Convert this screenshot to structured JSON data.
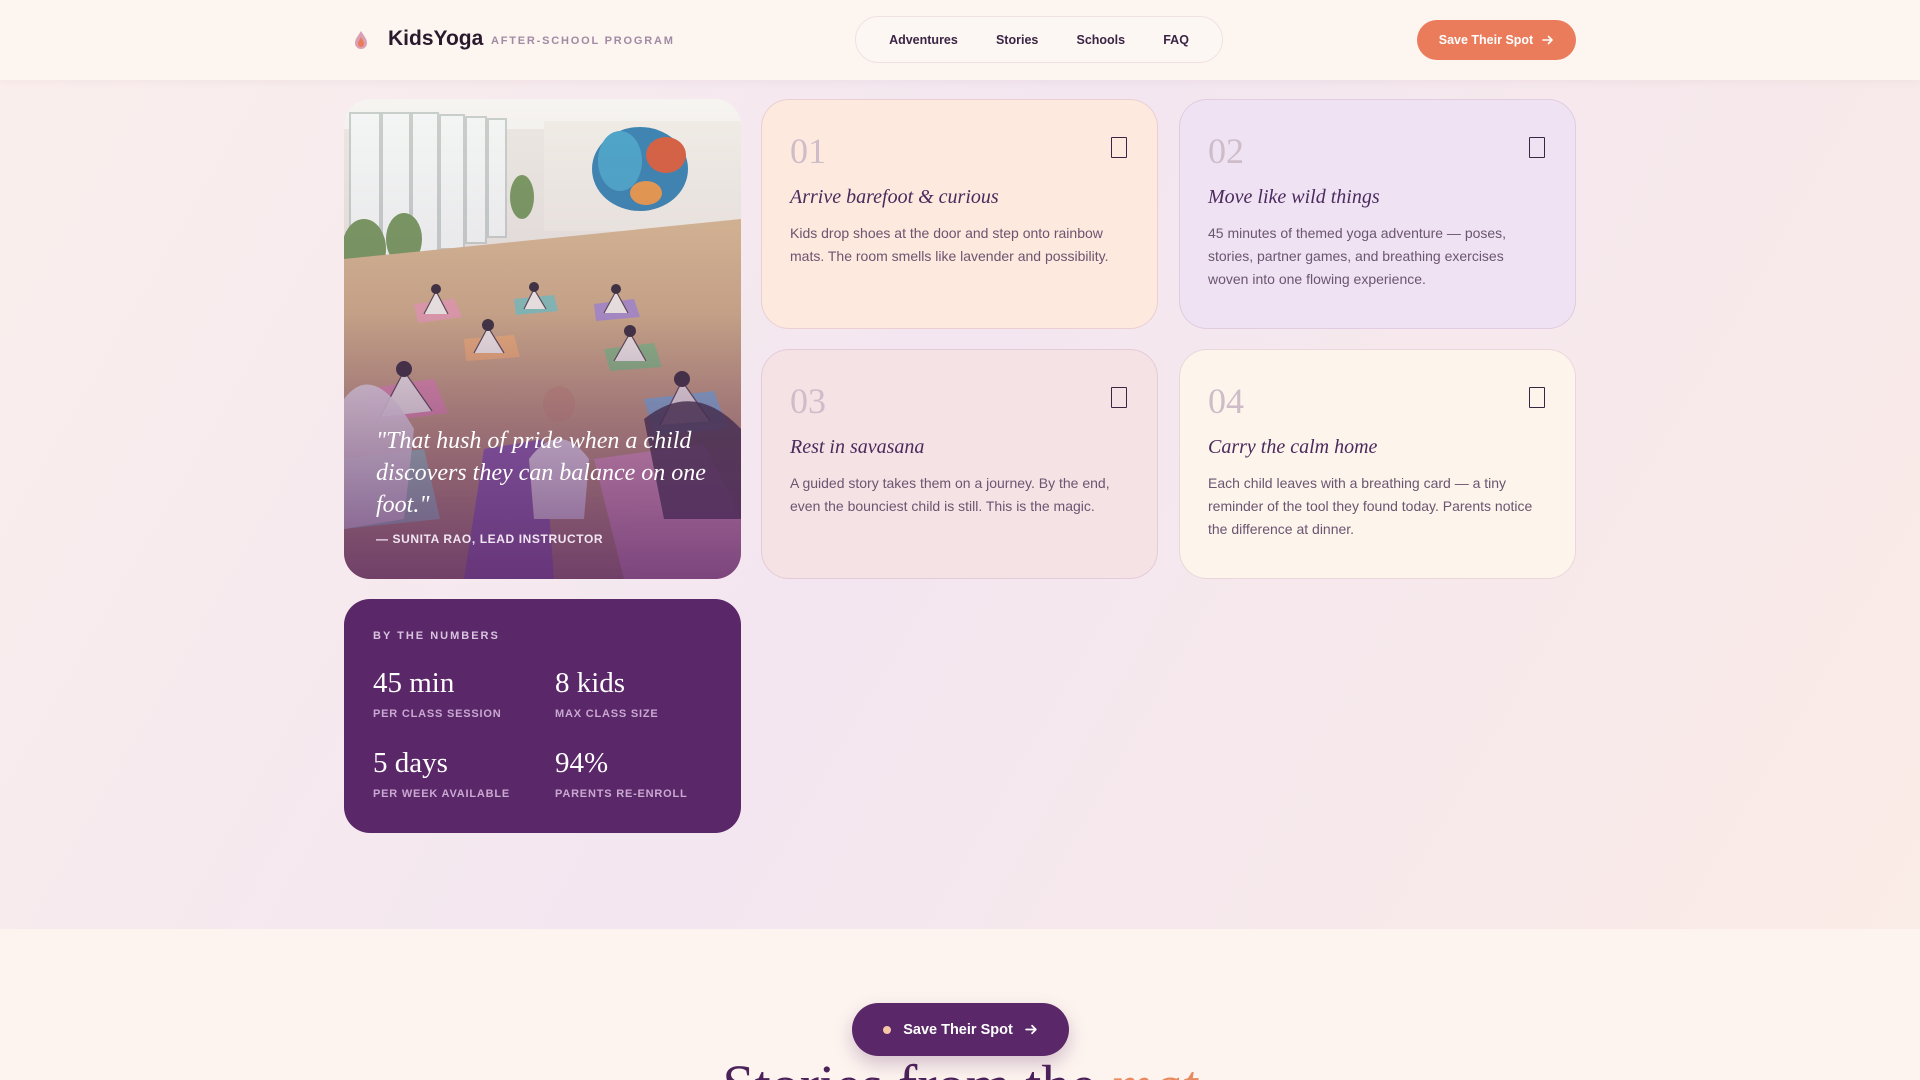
{
  "header": {
    "brand": "KidsYoga",
    "tagline": "AFTER-SCHOOL PROGRAM",
    "logo_icon": "drop-flame-icon",
    "nav": [
      "Adventures",
      "Stories",
      "Schools",
      "FAQ"
    ],
    "cta_label": "Save Their Spot",
    "cta_color": "#ea7c5c"
  },
  "photo_card": {
    "quote": "\"That hush of pride when a child discovers they can balance on one foot.\"",
    "author": "— SUNITA RAO, LEAD INSTRUCTOR"
  },
  "steps": [
    {
      "num": "01",
      "title": "Arrive barefoot & curious",
      "body": "Kids drop shoes at the door and step onto rainbow mats. The room smells like lavender and possibility.",
      "bg": "#fde9de",
      "icon": "bookmark-icon"
    },
    {
      "num": "02",
      "title": "Move like wild things",
      "body": "45 minutes of themed yoga adventure — poses, stories, partner games, and breathing exercises woven into one flowing experience.",
      "bg": "#efe3f3",
      "icon": "bookmark-icon"
    },
    {
      "num": "03",
      "title": "Rest in savasana",
      "body": "A guided story takes them on a journey. By the end, even the bounciest child is still. This is the magic.",
      "bg": "#f5e2e5",
      "icon": "bookmark-icon"
    },
    {
      "num": "04",
      "title": "Carry the calm home",
      "body": "Each child leaves with a breathing card — a tiny reminder of the tool they found today. Parents notice the difference at dinner.",
      "bg": "#fdf4ec",
      "icon": "bookmark-icon"
    }
  ],
  "stats": {
    "label": "BY THE NUMBERS",
    "items": [
      {
        "value": "45 min",
        "caption": "PER CLASS SESSION"
      },
      {
        "value": "8 kids",
        "caption": "MAX CLASS SIZE"
      },
      {
        "value": "5 days",
        "caption": "PER WEEK AVAILABLE"
      },
      {
        "value": "94%",
        "caption": "PARENTS RE-ENROLL"
      }
    ],
    "bg": "#5a2768"
  },
  "bottom": {
    "cta_label": "Save Their Spot",
    "heading_main": "Stories from the",
    "heading_accent": "mat"
  }
}
